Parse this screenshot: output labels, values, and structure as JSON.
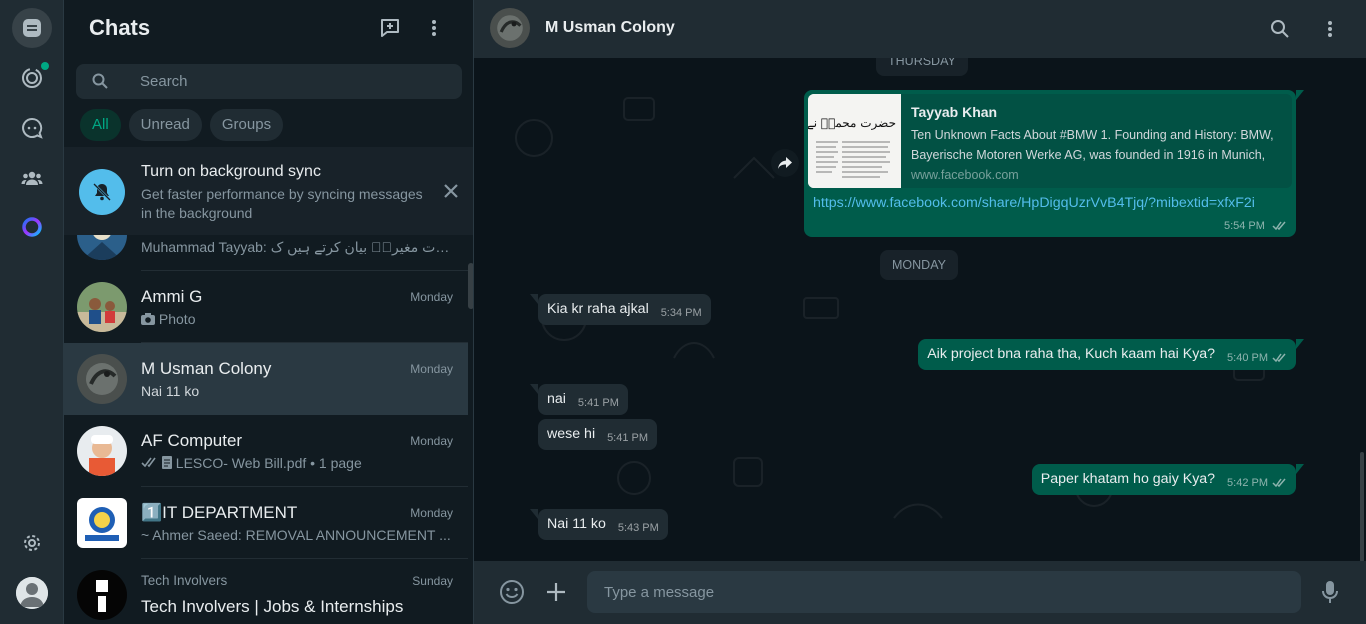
{
  "sidebar_title": "Chats",
  "search": {
    "placeholder": "Search"
  },
  "filters": [
    "All",
    "Unread",
    "Groups"
  ],
  "sync_banner": {
    "title": "Turn on background sync",
    "subtitle": "Get faster performance by syncing messages in the background"
  },
  "chats": [
    {
      "name": "",
      "time": "",
      "preview": "Muhammad Tayyab:  حضرت مغیرہؓ بیان کرتے ہیں ک..."
    },
    {
      "name": "Ammi G",
      "time": "Monday",
      "preview": "Photo"
    },
    {
      "name": "M Usman Colony",
      "time": "Monday",
      "preview": "Nai 11 ko"
    },
    {
      "name": "AF Computer",
      "time": "Monday",
      "preview": "LESCO- Web Bill.pdf • 1 page"
    },
    {
      "name": "1️⃣IT DEPARTMENT",
      "time": "Monday",
      "preview": "~ Ahmer Saeed: REMOVAL ANNOUNCEMENT ..."
    },
    {
      "name": "Tech Involvers | Jobs & Internships",
      "time": "Sunday",
      "preview": "Tech Involvers"
    }
  ],
  "conversation": {
    "title": "M Usman Colony",
    "date_thursday": "THURSDAY",
    "date_monday": "MONDAY",
    "link_message": {
      "title": "Tayyab Khan",
      "description": "Ten Unknown Facts About #BMW 1. Founding and History: BMW, Bayerische Motoren Werke AG, was founded in 1916 in Munich,",
      "domain": "www.facebook.com",
      "url": "https://www.facebook.com/share/HpDigqUzrVvB4Tjq/?mibextid=xfxF2i",
      "time": "5:54 PM",
      "thumb_text": "حضرت محمدؐ نے فرمایا"
    },
    "messages": [
      {
        "text": "Kia kr raha ajkal",
        "time": "5:34 PM"
      },
      {
        "text": "Aik project bna raha tha, Kuch kaam hai Kya?",
        "time": "5:40 PM"
      },
      {
        "text": "nai",
        "time": "5:41 PM"
      },
      {
        "text": "wese hi",
        "time": "5:41 PM"
      },
      {
        "text": "Paper khatam ho gaiy Kya?",
        "time": "5:42 PM"
      },
      {
        "text": "Nai 11 ko",
        "time": "5:43 PM"
      }
    ]
  },
  "composer": {
    "placeholder": "Type a message"
  },
  "colors": {
    "accent": "#00a884",
    "outgoing_bubble": "#005c4b",
    "incoming_bubble": "#202c33",
    "background": "#0b141a",
    "link": "#53bdeb"
  }
}
